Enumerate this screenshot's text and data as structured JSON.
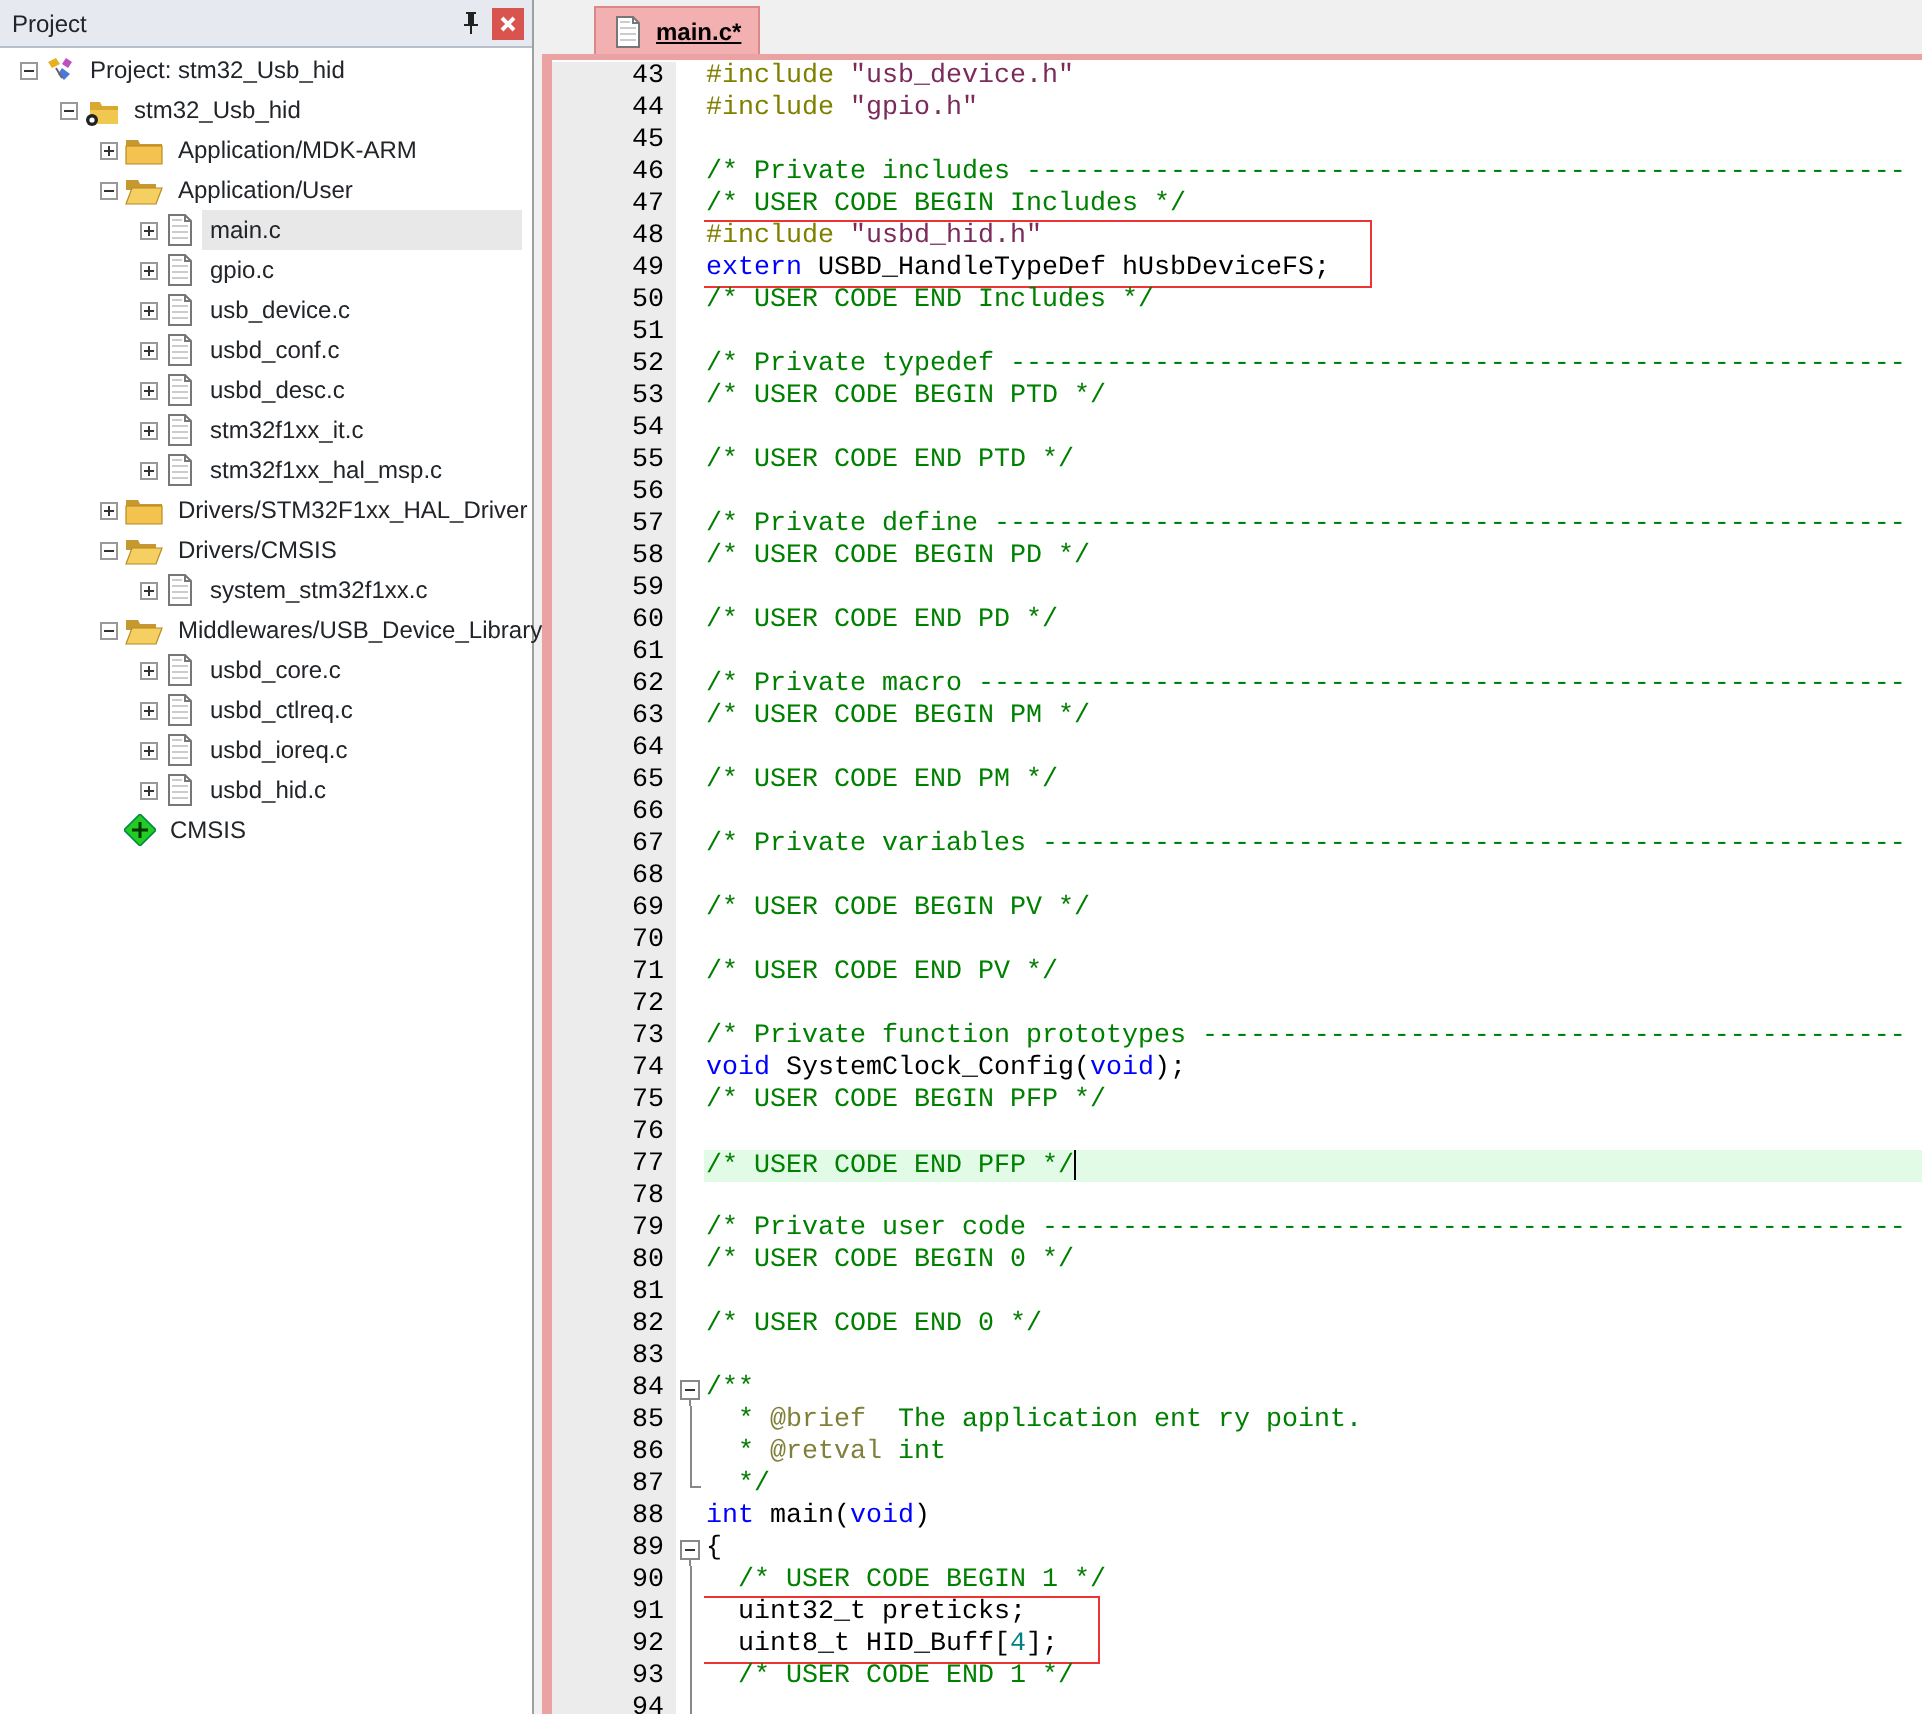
{
  "project_panel": {
    "title": "Project",
    "tree": [
      {
        "label": "Project: stm32_Usb_hid",
        "kind": "project",
        "expanded": true,
        "selected": false,
        "children": [
          {
            "label": "stm32_Usb_hid",
            "kind": "target",
            "expanded": true,
            "selected": false,
            "children": [
              {
                "label": "Application/MDK-ARM",
                "kind": "folder",
                "expanded": false,
                "selected": false
              },
              {
                "label": "Application/User",
                "kind": "folder",
                "expanded": true,
                "selected": false,
                "children": [
                  {
                    "label": "main.c",
                    "kind": "file",
                    "expanded": false,
                    "selected": true
                  },
                  {
                    "label": "gpio.c",
                    "kind": "file",
                    "expanded": false,
                    "selected": false
                  },
                  {
                    "label": "usb_device.c",
                    "kind": "file",
                    "expanded": false,
                    "selected": false
                  },
                  {
                    "label": "usbd_conf.c",
                    "kind": "file",
                    "expanded": false,
                    "selected": false
                  },
                  {
                    "label": "usbd_desc.c",
                    "kind": "file",
                    "expanded": false,
                    "selected": false
                  },
                  {
                    "label": "stm32f1xx_it.c",
                    "kind": "file",
                    "expanded": false,
                    "selected": false
                  },
                  {
                    "label": "stm32f1xx_hal_msp.c",
                    "kind": "file",
                    "expanded": false,
                    "selected": false
                  }
                ]
              },
              {
                "label": "Drivers/STM32F1xx_HAL_Driver",
                "kind": "folder",
                "expanded": false,
                "selected": false
              },
              {
                "label": "Drivers/CMSIS",
                "kind": "folder",
                "expanded": true,
                "selected": false,
                "children": [
                  {
                    "label": "system_stm32f1xx.c",
                    "kind": "file",
                    "expanded": false,
                    "selected": false
                  }
                ]
              },
              {
                "label": "Middlewares/USB_Device_Library",
                "kind": "folder",
                "expanded": true,
                "selected": false,
                "children": [
                  {
                    "label": "usbd_core.c",
                    "kind": "file",
                    "expanded": false,
                    "selected": false
                  },
                  {
                    "label": "usbd_ctlreq.c",
                    "kind": "file",
                    "expanded": false,
                    "selected": false
                  },
                  {
                    "label": "usbd_ioreq.c",
                    "kind": "file",
                    "expanded": false,
                    "selected": false
                  },
                  {
                    "label": "usbd_hid.c",
                    "kind": "file",
                    "expanded": false,
                    "selected": false
                  }
                ]
              },
              {
                "label": "CMSIS",
                "kind": "component",
                "selected": false
              }
            ]
          }
        ]
      }
    ]
  },
  "editor": {
    "tabs": [
      {
        "label": "main.c*",
        "selected": true
      }
    ],
    "lines": [
      {
        "number": "43",
        "kind": "plain",
        "current": false,
        "boxed": false,
        "tokens": [
          {
            "kind": "pp",
            "text": "#include "
          },
          {
            "kind": "str",
            "text": "\"usb_device.h\""
          }
        ]
      },
      {
        "number": "44",
        "kind": "plain",
        "current": false,
        "boxed": false,
        "tokens": [
          {
            "kind": "pp",
            "text": "#include "
          },
          {
            "kind": "str",
            "text": "\"gpio.h\""
          }
        ]
      },
      {
        "number": "45",
        "kind": "plain",
        "current": false,
        "boxed": false
      },
      {
        "number": "46",
        "kind": "plain",
        "current": false,
        "boxed": false,
        "tokens": [
          {
            "kind": "cm",
            "text": "/* Private includes -------------------------------------------------------"
          }
        ]
      },
      {
        "number": "47",
        "kind": "plain",
        "current": false,
        "boxed": false,
        "tokens": [
          {
            "kind": "cm",
            "text": "/* USER CODE BEGIN Includes */"
          }
        ]
      },
      {
        "number": "48",
        "kind": "plain",
        "current": false,
        "boxed": true,
        "tokens": [
          {
            "kind": "pp",
            "text": "#include "
          },
          {
            "kind": "str",
            "text": "\"usbd_hid.h\""
          }
        ]
      },
      {
        "number": "49",
        "kind": "plain",
        "current": false,
        "boxed": true,
        "tokens": [
          {
            "kind": "kw",
            "text": "extern"
          },
          {
            "kind": "tx",
            "text": " USBD_HandleTypeDef hUsbDeviceFS;"
          }
        ]
      },
      {
        "number": "50",
        "kind": "plain",
        "current": false,
        "boxed": false,
        "tokens": [
          {
            "kind": "cm",
            "text": "/* USER CODE END Includes */"
          }
        ]
      },
      {
        "number": "51",
        "kind": "plain",
        "current": false,
        "boxed": false
      },
      {
        "number": "52",
        "kind": "plain",
        "current": false,
        "boxed": false,
        "tokens": [
          {
            "kind": "cm",
            "text": "/* Private typedef --------------------------------------------------------"
          }
        ]
      },
      {
        "number": "53",
        "kind": "plain",
        "current": false,
        "boxed": false,
        "tokens": [
          {
            "kind": "cm",
            "text": "/* USER CODE BEGIN PTD */"
          }
        ]
      },
      {
        "number": "54",
        "kind": "plain",
        "current": false,
        "boxed": false
      },
      {
        "number": "55",
        "kind": "plain",
        "current": false,
        "boxed": false,
        "tokens": [
          {
            "kind": "cm",
            "text": "/* USER CODE END PTD */"
          }
        ]
      },
      {
        "number": "56",
        "kind": "plain",
        "current": false,
        "boxed": false
      },
      {
        "number": "57",
        "kind": "plain",
        "current": false,
        "boxed": false,
        "tokens": [
          {
            "kind": "cm",
            "text": "/* Private define ---------------------------------------------------------"
          }
        ]
      },
      {
        "number": "58",
        "kind": "plain",
        "current": false,
        "boxed": false,
        "tokens": [
          {
            "kind": "cm",
            "text": "/* USER CODE BEGIN PD */"
          }
        ]
      },
      {
        "number": "59",
        "kind": "plain",
        "current": false,
        "boxed": false
      },
      {
        "number": "60",
        "kind": "plain",
        "current": false,
        "boxed": false,
        "tokens": [
          {
            "kind": "cm",
            "text": "/* USER CODE END PD */"
          }
        ]
      },
      {
        "number": "61",
        "kind": "plain",
        "current": false,
        "boxed": false
      },
      {
        "number": "62",
        "kind": "plain",
        "current": false,
        "boxed": false,
        "tokens": [
          {
            "kind": "cm",
            "text": "/* Private macro ----------------------------------------------------------"
          }
        ]
      },
      {
        "number": "63",
        "kind": "plain",
        "current": false,
        "boxed": false,
        "tokens": [
          {
            "kind": "cm",
            "text": "/* USER CODE BEGIN PM */"
          }
        ]
      },
      {
        "number": "64",
        "kind": "plain",
        "current": false,
        "boxed": false
      },
      {
        "number": "65",
        "kind": "plain",
        "current": false,
        "boxed": false,
        "tokens": [
          {
            "kind": "cm",
            "text": "/* USER CODE END PM */"
          }
        ]
      },
      {
        "number": "66",
        "kind": "plain",
        "current": false,
        "boxed": false
      },
      {
        "number": "67",
        "kind": "plain",
        "current": false,
        "boxed": false,
        "tokens": [
          {
            "kind": "cm",
            "text": "/* Private variables ------------------------------------------------------"
          }
        ]
      },
      {
        "number": "68",
        "kind": "plain",
        "current": false,
        "boxed": false
      },
      {
        "number": "69",
        "kind": "plain",
        "current": false,
        "boxed": false,
        "tokens": [
          {
            "kind": "cm",
            "text": "/* USER CODE BEGIN PV */"
          }
        ]
      },
      {
        "number": "70",
        "kind": "plain",
        "current": false,
        "boxed": false
      },
      {
        "number": "71",
        "kind": "plain",
        "current": false,
        "boxed": false,
        "tokens": [
          {
            "kind": "cm",
            "text": "/* USER CODE END PV */"
          }
        ]
      },
      {
        "number": "72",
        "kind": "plain",
        "current": false,
        "boxed": false
      },
      {
        "number": "73",
        "kind": "plain",
        "current": false,
        "boxed": false,
        "tokens": [
          {
            "kind": "cm",
            "text": "/* Private function prototypes --------------------------------------------"
          }
        ]
      },
      {
        "number": "74",
        "kind": "plain",
        "current": false,
        "boxed": false,
        "tokens": [
          {
            "kind": "kw",
            "text": "void"
          },
          {
            "kind": "tx",
            "text": " SystemClock_Config("
          },
          {
            "kind": "kw",
            "text": "void"
          },
          {
            "kind": "tx",
            "text": ");"
          }
        ]
      },
      {
        "number": "75",
        "kind": "plain",
        "current": false,
        "boxed": false,
        "tokens": [
          {
            "kind": "cm",
            "text": "/* USER CODE BEGIN PFP */"
          }
        ]
      },
      {
        "number": "76",
        "kind": "plain",
        "current": false,
        "boxed": false
      },
      {
        "number": "77",
        "kind": "plain",
        "current": true,
        "boxed": false,
        "tokens": [
          {
            "kind": "cm",
            "text": "/* USER CODE END PFP */"
          }
        ]
      },
      {
        "number": "78",
        "kind": "plain",
        "current": false,
        "boxed": false
      },
      {
        "number": "79",
        "kind": "plain",
        "current": false,
        "boxed": false,
        "tokens": [
          {
            "kind": "cm",
            "text": "/* Private user code ------------------------------------------------------"
          }
        ]
      },
      {
        "number": "80",
        "kind": "plain",
        "current": false,
        "boxed": false,
        "tokens": [
          {
            "kind": "cm",
            "text": "/* USER CODE BEGIN 0 */"
          }
        ]
      },
      {
        "number": "81",
        "kind": "plain",
        "current": false,
        "boxed": false
      },
      {
        "number": "82",
        "kind": "plain",
        "current": false,
        "boxed": false,
        "tokens": [
          {
            "kind": "cm",
            "text": "/* USER CODE END 0 */"
          }
        ]
      },
      {
        "number": "83",
        "kind": "plain",
        "current": false,
        "boxed": false
      },
      {
        "number": "84",
        "kind": "fold_start",
        "current": false,
        "boxed": false,
        "tokens": [
          {
            "kind": "cm",
            "text": "/**"
          }
        ]
      },
      {
        "number": "85",
        "kind": "fold_line",
        "current": false,
        "boxed": false,
        "tokens": [
          {
            "kind": "cm",
            "text": "  * "
          },
          {
            "kind": "tag",
            "text": "@brief"
          },
          {
            "kind": "cm",
            "text": "  The application ent ry point."
          }
        ]
      },
      {
        "number": "86",
        "kind": "fold_line",
        "current": false,
        "boxed": false,
        "tokens": [
          {
            "kind": "cm",
            "text": "  * "
          },
          {
            "kind": "tag",
            "text": "@retval"
          },
          {
            "kind": "cm",
            "text": " int"
          }
        ]
      },
      {
        "number": "87",
        "kind": "fold_end",
        "current": false,
        "boxed": false,
        "tokens": [
          {
            "kind": "cm",
            "text": "  */"
          }
        ]
      },
      {
        "number": "88",
        "kind": "plain",
        "current": false,
        "boxed": false,
        "tokens": [
          {
            "kind": "kw",
            "text": "int"
          },
          {
            "kind": "tx",
            "text": " main("
          },
          {
            "kind": "kw",
            "text": "void"
          },
          {
            "kind": "tx",
            "text": ")"
          }
        ]
      },
      {
        "number": "89",
        "kind": "fold_start",
        "current": false,
        "boxed": false,
        "tokens": [
          {
            "kind": "tx",
            "text": "{"
          }
        ]
      },
      {
        "number": "90",
        "kind": "fold_line",
        "current": false,
        "boxed": false,
        "tokens": [
          {
            "kind": "cm",
            "text": "  /* USER CODE BEGIN 1 */"
          }
        ]
      },
      {
        "number": "91",
        "kind": "fold_line",
        "current": false,
        "boxed": true,
        "tokens": [
          {
            "kind": "tx",
            "text": "  uint32_t preticks;"
          }
        ]
      },
      {
        "number": "92",
        "kind": "fold_line",
        "current": false,
        "boxed": true,
        "tokens": [
          {
            "kind": "tx",
            "text": "  uint8_t HID_Buff["
          },
          {
            "kind": "num",
            "text": "4"
          },
          {
            "kind": "tx",
            "text": "];"
          }
        ]
      },
      {
        "number": "93",
        "kind": "fold_line",
        "current": false,
        "boxed": false,
        "tokens": [
          {
            "kind": "cm",
            "text": "  /* USER CODE END 1 */"
          }
        ]
      },
      {
        "number": "94",
        "kind": "fold_line",
        "current": false,
        "boxed": false
      }
    ]
  }
}
